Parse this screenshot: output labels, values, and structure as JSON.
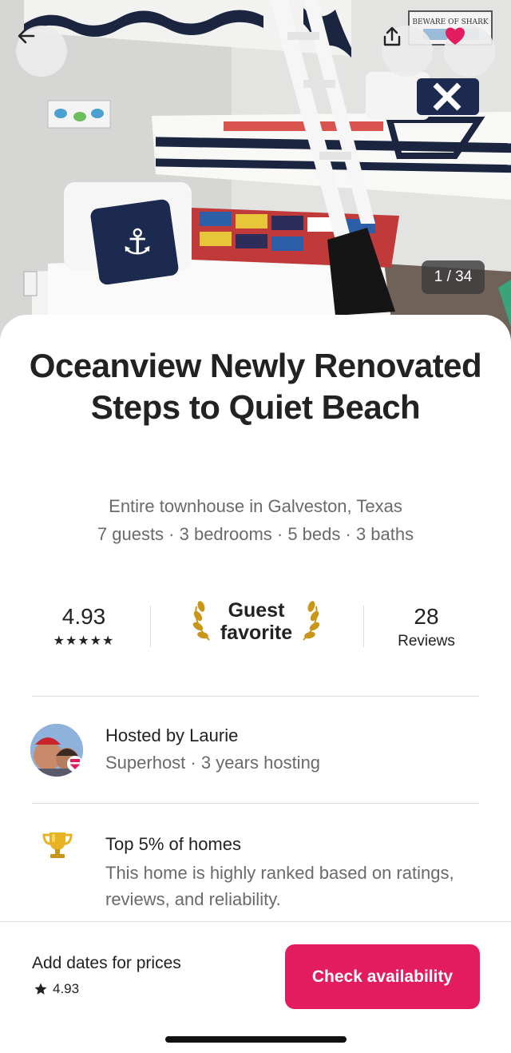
{
  "hero": {
    "photo_counter": "1 / 34",
    "sign_text": "BEWARE OF SHARK"
  },
  "listing": {
    "title": "Oceanview Newly Renovated Steps to Quiet Beach",
    "type_location": "Entire townhouse in Galveston, Texas",
    "details": "7 guests · 3 bedrooms · 5 beds · 3 baths"
  },
  "stats": {
    "rating": "4.93",
    "stars": "★★★★★",
    "guest_favorite_line1": "Guest",
    "guest_favorite_line2": "favorite",
    "reviews_count": "28",
    "reviews_label": "Reviews"
  },
  "host": {
    "name_line": "Hosted by Laurie",
    "sub_line": "Superhost · 3 years hosting"
  },
  "highlight": {
    "title": "Top 5% of homes",
    "description": "This home is highly ranked based on ratings, reviews, and reliability."
  },
  "footer": {
    "add_dates": "Add dates for prices",
    "rating": "4.93",
    "check_button": "Check availability"
  },
  "colors": {
    "brand": "#e31c5f",
    "heart": "#e31c5f",
    "text_primary": "#222222",
    "text_secondary": "#6a6a6a"
  },
  "icons": {
    "back": "arrow-left-icon",
    "share": "share-icon",
    "favorite": "heart-icon",
    "laurel": "laurel-icon",
    "trophy": "trophy-icon",
    "star": "star-icon"
  }
}
